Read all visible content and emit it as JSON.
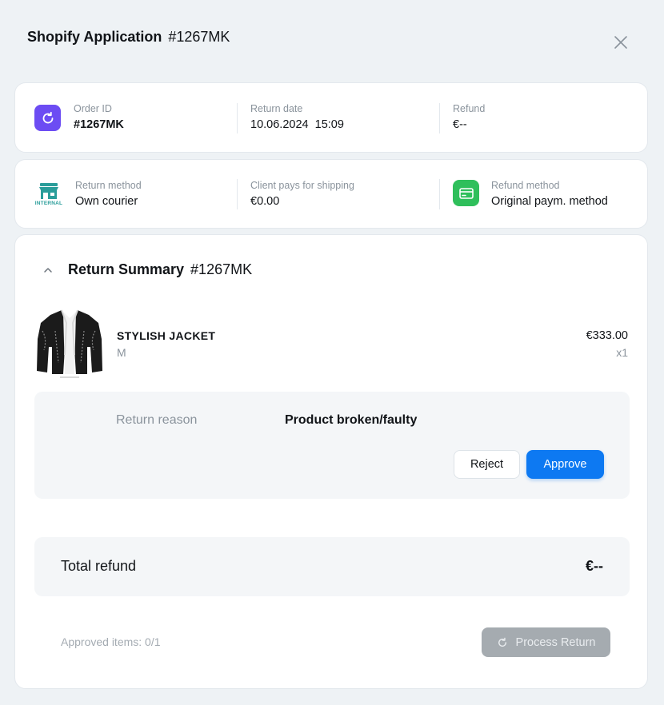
{
  "header": {
    "title": "Shopify Application",
    "order_number": "#1267MK"
  },
  "info_card": {
    "order_id": {
      "label": "Order ID",
      "value": "#1267MK"
    },
    "return_date": {
      "label": "Return date",
      "value": "10.06.2024  15:09"
    },
    "refund": {
      "label": "Refund",
      "value": "€--"
    }
  },
  "method_card": {
    "return_method": {
      "label": "Return method",
      "value": "Own courier",
      "icon_caption": "INTERNAL"
    },
    "shipping": {
      "label": "Client pays for shipping",
      "value": "€0.00"
    },
    "refund_method": {
      "label": "Refund method",
      "value": "Original paym. method"
    }
  },
  "summary": {
    "title": "Return Summary",
    "order_number": "#1267MK",
    "product": {
      "name": "STYLISH JACKET",
      "size": "M",
      "price": "€333.00",
      "quantity": "x1"
    },
    "reason": {
      "label": "Return reason",
      "value": "Product broken/faulty"
    },
    "reject_label": "Reject",
    "approve_label": "Approve",
    "total": {
      "label": "Total refund",
      "value": "€--"
    },
    "approved_items": "Approved items: 0/1",
    "process_label": "Process Return"
  },
  "colors": {
    "accent": "#0d79f2",
    "order_icon_bg": "#6c4cf3",
    "refund_icon_bg": "#2fbf5b",
    "store_icon": "#2a9d9a",
    "disabled_button": "#a5abb0"
  },
  "icons": [
    "close-icon",
    "refresh-icon",
    "store-icon",
    "card-icon",
    "chevron-up-icon",
    "jacket-image"
  ]
}
